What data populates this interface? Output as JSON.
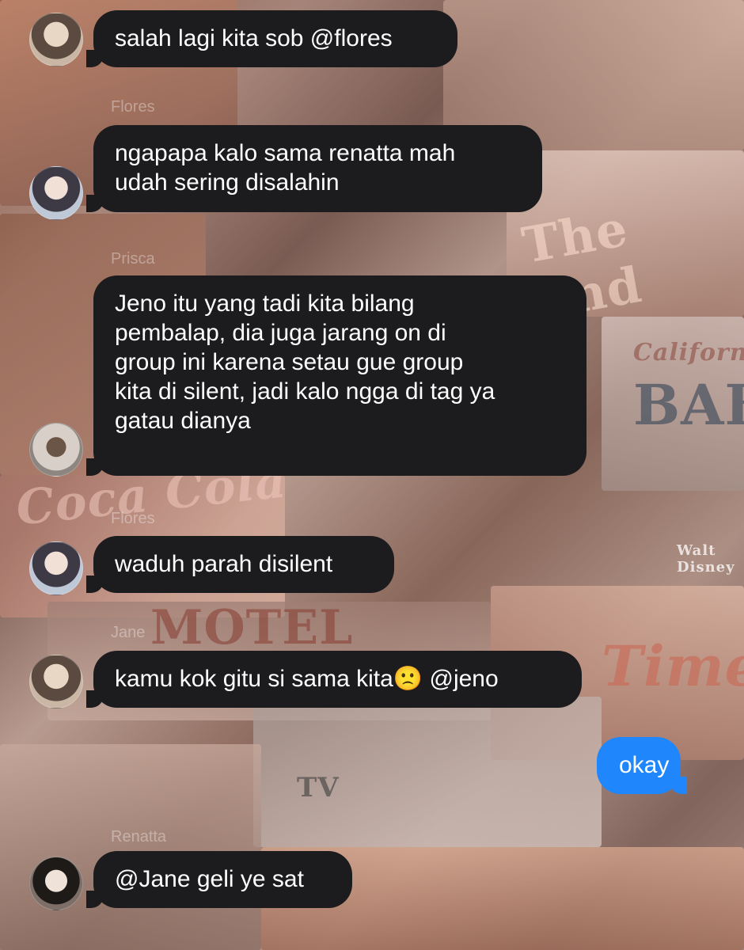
{
  "colors": {
    "incoming_bubble": "#1c1b1e",
    "outgoing_bubble": "#1f87fb",
    "bubble_text": "#ffffff"
  },
  "background": {
    "decorative_texts": [
      "The End",
      "BAB",
      "California",
      "MOTEL",
      "Time",
      "TV",
      "Walt Disney",
      "Coca Cola"
    ]
  },
  "sender_names": {
    "flores": "Flores",
    "prisca": "Prisca",
    "jane": "Jane",
    "renatta": "Renatta"
  },
  "messages": [
    {
      "direction": "incoming",
      "sender": "Jane",
      "text": "salah lagi kita sob @flores"
    },
    {
      "direction": "incoming",
      "sender": "Flores",
      "text": "ngapapa kalo sama renatta mah\nudah sering disalahin"
    },
    {
      "direction": "incoming",
      "sender": "Prisca",
      "text": "Jeno itu yang tadi kita bilang\npembalap, dia juga jarang on di\ngroup ini karena setau gue group\nkita di silent, jadi kalo ngga di tag ya\ngatau dianya"
    },
    {
      "direction": "incoming",
      "sender": "Flores",
      "text": "waduh parah disilent"
    },
    {
      "direction": "incoming",
      "sender": "Jane",
      "text": "kamu kok gitu si sama kita🙁 @jeno"
    },
    {
      "direction": "outgoing",
      "sender": "me",
      "text": "okay"
    },
    {
      "direction": "incoming",
      "sender": "Renatta",
      "text": "@Jane geli ye sat"
    }
  ]
}
